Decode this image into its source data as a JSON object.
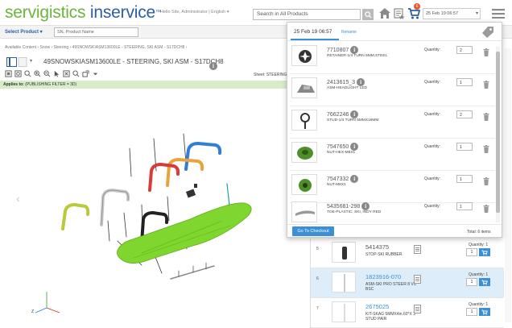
{
  "header": {
    "logo_primary": "servigistics",
    "logo_secondary": " inservice",
    "logo_tm": "™",
    "greeting": "Hello Site, Administrator  |  English ▾",
    "search_placeholder": "Search in All Products",
    "cart_badge": "6",
    "cart_date": "25 Feb 19 06:57",
    "cart_date_chevron": "▾"
  },
  "product_bar": {
    "select_label": "Select Product ▾",
    "input_placeholder": "SN, Product Name"
  },
  "breadcrumb": "Available Content  ›  Snow  ›  Steering  ›  49SNOWSKIASM13600LE - STEERING, SKI ASM - S17DCH8  ›",
  "document": {
    "title": "49SNOWSKIASM13600LE - STEERING, SKI ASM - S17DCH8",
    "chevron": "▾",
    "info_glyph": "i"
  },
  "viewer": {
    "sheet_label": "Sheet: STEERING",
    "applies_label": "Applies to:",
    "applies_value": " (PUBLISHING FILTER = 3D)",
    "left_arrow": "‹"
  },
  "cart_popup": {
    "tab_label": "25 Feb 19 06:57",
    "rename_label": "Rename",
    "quantity_label": "Quantity:",
    "info_glyph": "i",
    "items": [
      {
        "part": "7710807",
        "desc": "RETAINER-1/4 TURN 5MM.STEEL",
        "qty": "2"
      },
      {
        "part": "2413615_3",
        "desc": "ASM-HEADLIGHT LED",
        "qty": "1"
      },
      {
        "part": "7662246",
        "desc": "STUD-1/4 TURN 5MMX16MM",
        "qty": "2"
      },
      {
        "part": "7547650",
        "desc": "NUT-HEX-M8X1",
        "qty": "1"
      },
      {
        "part": "7547332",
        "desc": "NUT-M8X1",
        "qty": "1"
      },
      {
        "part": "5435681-298",
        "desc": "TOE-PLASTIC, SKI, INDY RED",
        "qty": "1"
      }
    ],
    "checkout_label": "Go To Checkout",
    "total_label": "Total: 6 items"
  },
  "parts_list": {
    "rows": [
      {
        "index": "5",
        "part": "5414375",
        "desc": "STOP-SKI RUBBER",
        "qty_label": "Quantity: 1",
        "qty": "1"
      },
      {
        "index": "6",
        "part": "1823916-070",
        "desc": "ASM-SKI PRO STEER 8 VC BSC",
        "qty_label": "Quantity: 1",
        "qty": "1"
      },
      {
        "index": "7",
        "part": "2675025",
        "desc": "KIT-SKAG 5MMX4in.60°X 3 STUD PAIR",
        "qty_label": "Quantity: 1",
        "qty": "1"
      }
    ]
  },
  "colors": {
    "brand_green": "#6db43e",
    "brand_blue": "#2c5ea3",
    "accent_blue": "#3a8fd6",
    "applies_bg": "#d7ecc9",
    "badge": "#e05a2b",
    "ski_green": "#7fd62e"
  },
  "icons": [
    "search-icon",
    "home-icon",
    "bom-icon",
    "cart-icon",
    "menu-icon",
    "document-icon",
    "info-icon",
    "trash-icon",
    "tag-icon",
    "note-icon",
    "cart-add-icon"
  ]
}
